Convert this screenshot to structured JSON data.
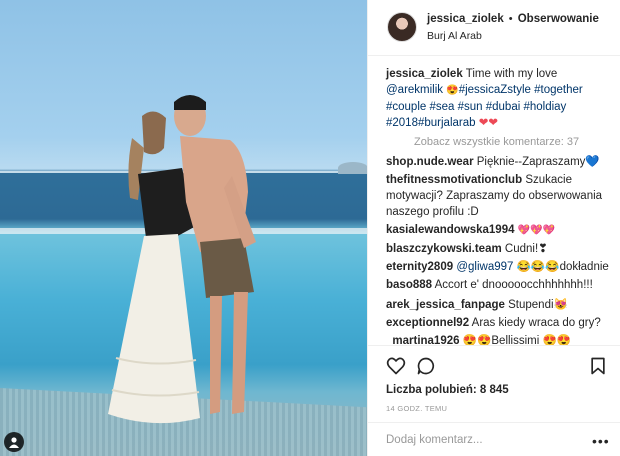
{
  "header": {
    "username": "jessica_ziolek",
    "separator": "•",
    "follow_label": "Obserwowanie",
    "location": "Burj Al Arab"
  },
  "caption": {
    "username": "jessica_ziolek",
    "text_1": "Time with my love",
    "mention": "@arekmilik",
    "emoji_1": "😍",
    "tags": "#jessicaZstyle #together #couple #sea #sun #dubai #holdiay #2018#burjalarab",
    "hearts": "❤❤"
  },
  "view_all": "Zobacz wszystkie komentarze: 37",
  "comments": [
    {
      "user": "shop.nude.wear",
      "text": "Pięknie--Zapraszamy💙"
    },
    {
      "user": "thefitnessmotivationclub",
      "text": "Szukacie motywacji? Zapraszamy do obserwowania naszego profilu :D"
    },
    {
      "user": "kasialewandowska1994",
      "text": "💖💖💖"
    },
    {
      "user": "blaszczykowski.team",
      "text": "Cudni!❣"
    },
    {
      "user": "eternity2809",
      "mention": "@gliwa997",
      "text": "😂😂😂dokładnie"
    },
    {
      "user": "baso888",
      "text": "Accort e' dnooooocchhhhhhh!!!"
    },
    {
      "user": "arek_jessica_fanpage",
      "text": "Stupendi😻"
    },
    {
      "user": "exceptionnel92",
      "text": "Aras kiedy wraca do gry?"
    },
    {
      "user": "_martina1926",
      "text": "😍😍Bellissimi 😍😍"
    }
  ],
  "actions": {
    "icons": [
      "heart-icon",
      "comment-icon",
      "bookmark-icon"
    ],
    "likes": "Liczba polubień: 8 845",
    "time": "14 GODZ. TEMU"
  },
  "add_comment": {
    "placeholder": "Dodaj komentarz...",
    "more": "•••"
  },
  "colors": {
    "link": "#003569",
    "muted": "#999999",
    "heart": "#ed4956",
    "border": "#efefef"
  }
}
